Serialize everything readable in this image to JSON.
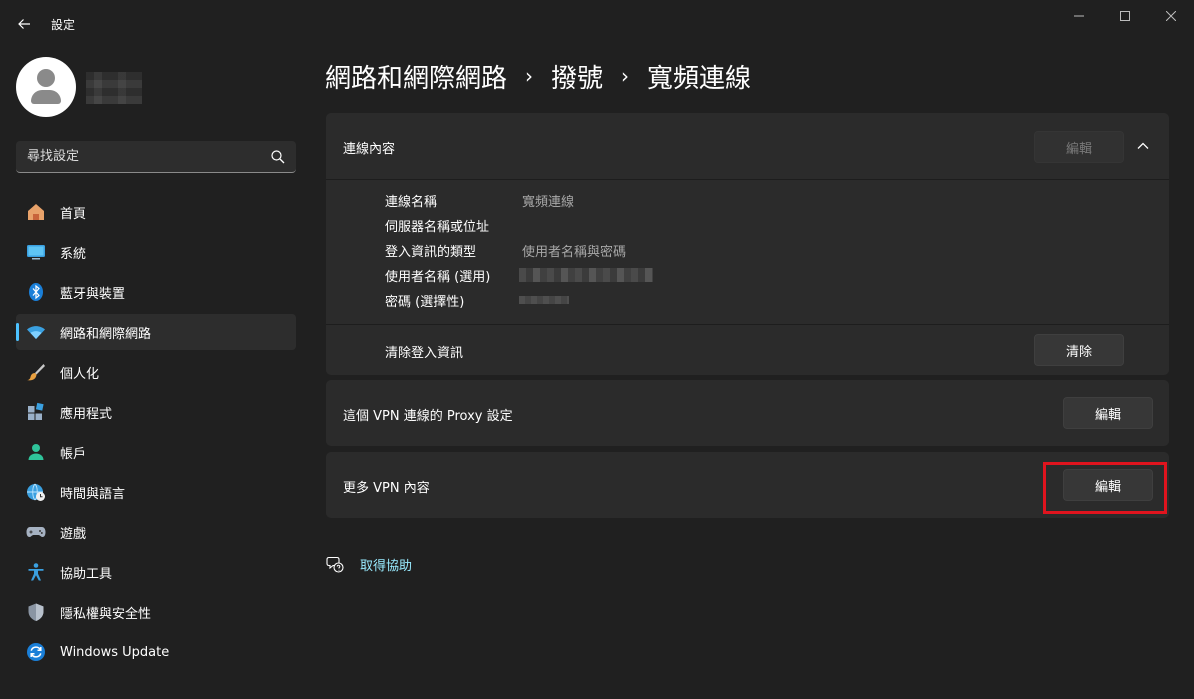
{
  "titlebar": {
    "title": "設定",
    "back_icon": "arrow-left-icon",
    "controls": [
      "minimize-icon",
      "maximize-icon",
      "close-icon"
    ]
  },
  "profile": {
    "avatar_icon": "person-icon"
  },
  "search": {
    "placeholder": "尋找設定",
    "icon": "search-icon"
  },
  "sidebar": {
    "items": [
      {
        "label": "首頁",
        "icon": "home-icon",
        "selected": false
      },
      {
        "label": "系統",
        "icon": "monitor-icon",
        "selected": false
      },
      {
        "label": "藍牙與裝置",
        "icon": "bluetooth-icon",
        "selected": false
      },
      {
        "label": "網路和網際網路",
        "icon": "wifi-icon",
        "selected": true
      },
      {
        "label": "個人化",
        "icon": "brush-icon",
        "selected": false
      },
      {
        "label": "應用程式",
        "icon": "apps-icon",
        "selected": false
      },
      {
        "label": "帳戶",
        "icon": "account-icon",
        "selected": false
      },
      {
        "label": "時間與語言",
        "icon": "globe-clock-icon",
        "selected": false
      },
      {
        "label": "遊戲",
        "icon": "gamepad-icon",
        "selected": false
      },
      {
        "label": "協助工具",
        "icon": "accessibility-icon",
        "selected": false
      },
      {
        "label": "隱私權與安全性",
        "icon": "shield-icon",
        "selected": false
      },
      {
        "label": "Windows Update",
        "icon": "update-icon",
        "selected": false
      }
    ]
  },
  "breadcrumb": {
    "items": [
      "網路和網際網路",
      "撥號",
      "寬頻連線"
    ],
    "separator": "›"
  },
  "connection_properties": {
    "title": "連線內容",
    "edit_label": "編輯",
    "edit_disabled": true,
    "expanded": true,
    "rows": [
      {
        "label": "連線名稱",
        "value": "寬頻連線"
      },
      {
        "label": "伺服器名稱或位址",
        "value": ""
      },
      {
        "label": "登入資訊的類型",
        "value": "使用者名稱與密碼"
      },
      {
        "label": "使用者名稱 (選用)",
        "value": ""
      },
      {
        "label": "密碼 (選擇性)",
        "value": ""
      }
    ],
    "clear_label": "清除登入資訊",
    "clear_button": "清除"
  },
  "proxy_card": {
    "label": "這個 VPN 連線的 Proxy 設定",
    "button": "編輯"
  },
  "more_card": {
    "label": "更多 VPN 內容",
    "button": "編輯"
  },
  "help": {
    "label": "取得協助",
    "icon": "help-chat-icon"
  },
  "colors": {
    "background": "#202020",
    "card": "#2b2b2b",
    "accent": "#4cc2ff",
    "link": "#99ebff",
    "highlight": "#e0141e"
  }
}
